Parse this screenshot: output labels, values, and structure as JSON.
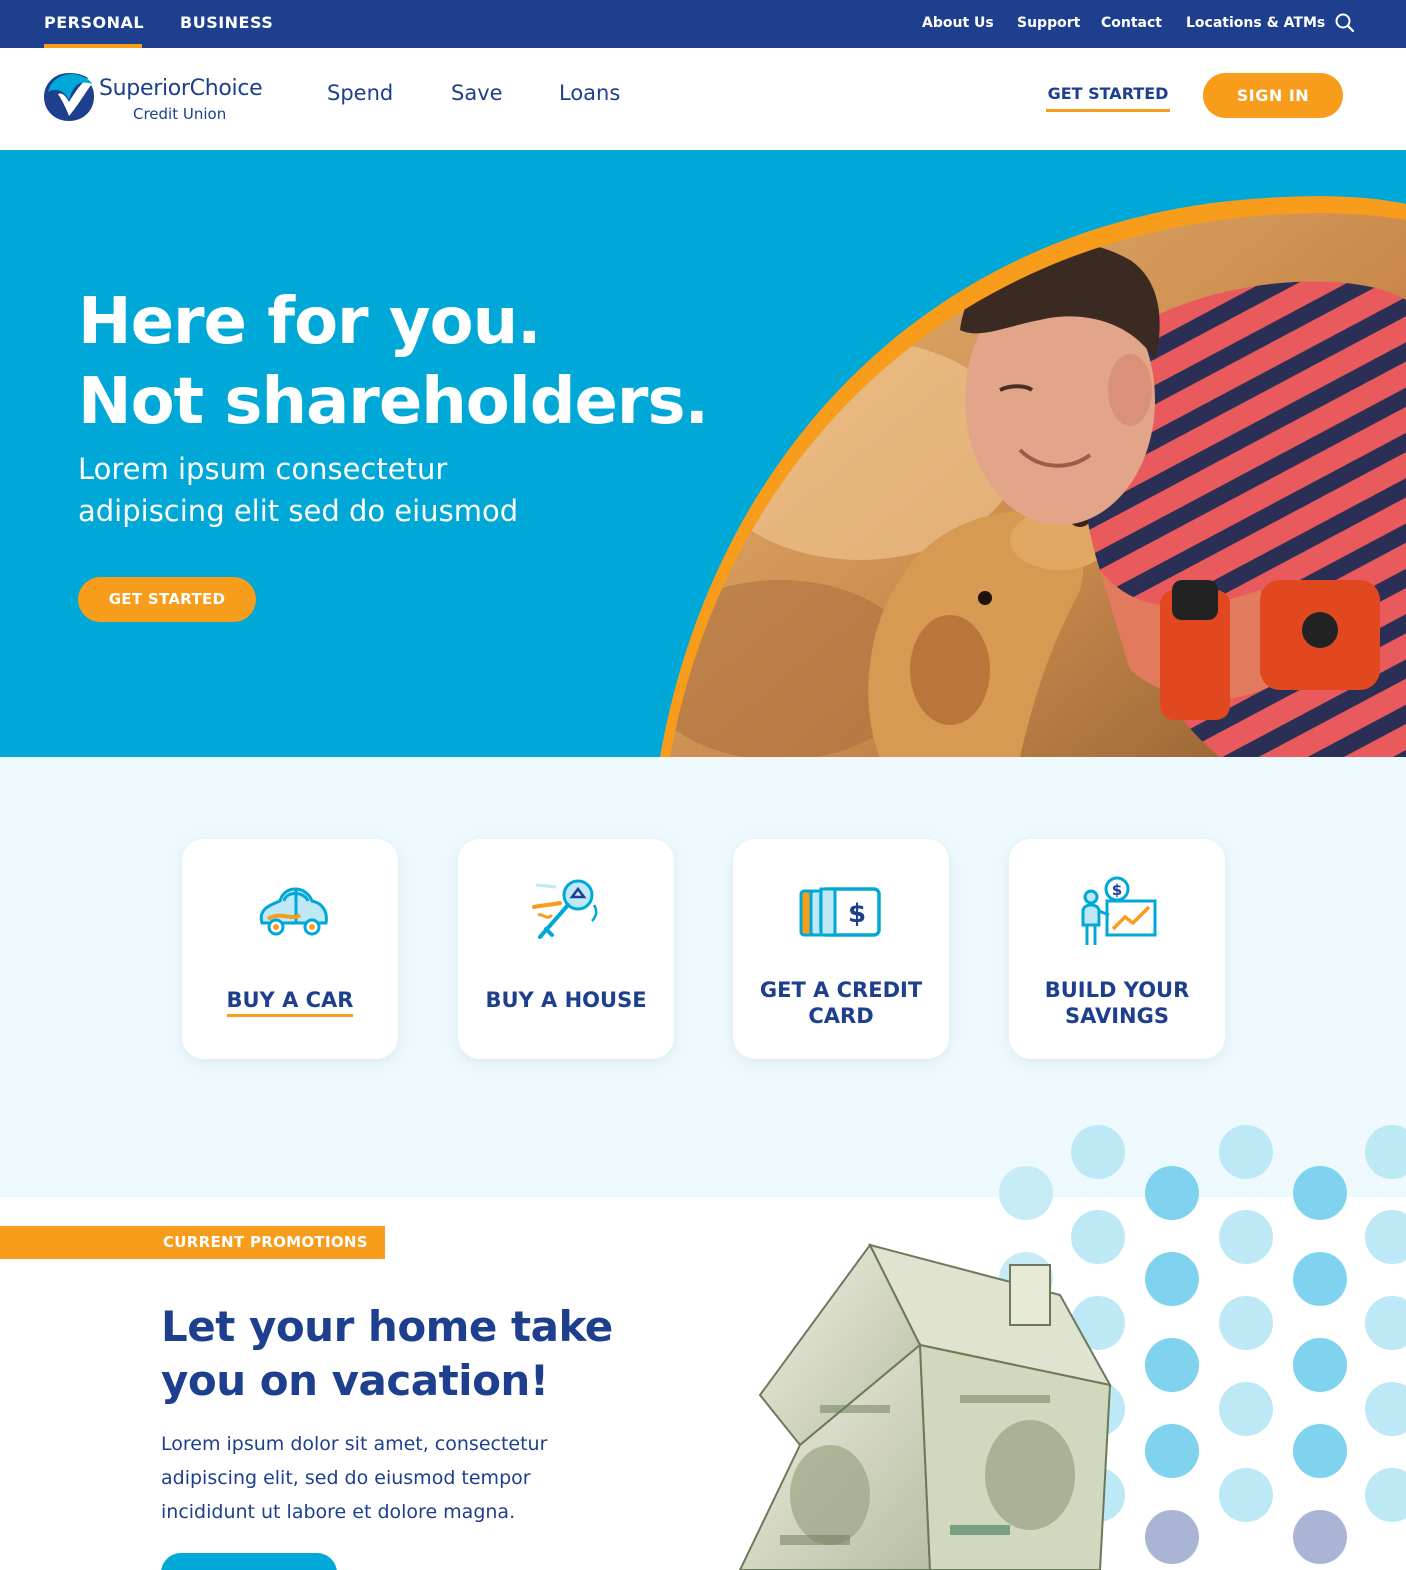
{
  "utility_bar": {
    "segments": [
      {
        "label": "PERSONAL",
        "active": true
      },
      {
        "label": "BUSINESS",
        "active": false
      }
    ],
    "links": [
      "About Us",
      "Support",
      "Contact",
      "Locations & ATMs"
    ],
    "search_icon": "search-icon"
  },
  "header": {
    "logo": {
      "name": "SuperiorChoice",
      "sub": "Credit Union"
    },
    "nav": [
      "Spend",
      "Save",
      "Loans"
    ],
    "get_started": "GET STARTED",
    "sign_in": "SIGN IN"
  },
  "hero": {
    "title_line1": "Here for you.",
    "title_line2": "Not shareholders.",
    "subtitle_line1": "Lorem ipsum consectetur",
    "subtitle_line2": "adipiscing elit sed do eiusmod",
    "cta": "GET STARTED"
  },
  "quick_links": [
    {
      "label_line1": "BUY A CAR",
      "label_line2": "",
      "icon": "car-icon"
    },
    {
      "label_line1": "BUY A HOUSE",
      "label_line2": "",
      "icon": "house-key-icon"
    },
    {
      "label_line1": "GET A CREDIT",
      "label_line2": "CARD",
      "icon": "credit-card-icon"
    },
    {
      "label_line1": "BUILD YOUR",
      "label_line2": "SAVINGS",
      "icon": "savings-growth-icon"
    }
  ],
  "promo": {
    "tag": "CURRENT PROMOTIONS",
    "title_line1": "Let your home take",
    "title_line2": "you on vacation!",
    "body": "Lorem ipsum dolor sit amet, consectetur adipiscing elit, sed do eiusmod tempor incididunt ut labore et dolore magna."
  },
  "colors": {
    "navy": "#1d3f8d",
    "orange": "#f89c1c",
    "cyan": "#00a8d8",
    "pale_blue": "#eef9fd"
  }
}
